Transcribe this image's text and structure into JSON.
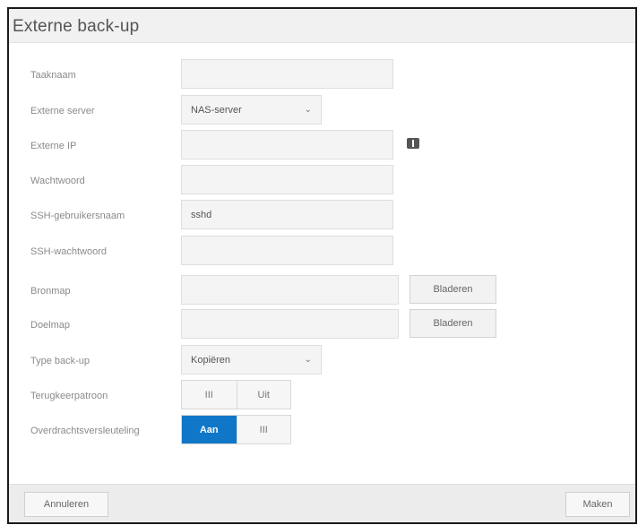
{
  "dialog": {
    "title": "Externe back-up"
  },
  "form": {
    "task_name": {
      "label": "Taaknaam",
      "value": ""
    },
    "remote_server": {
      "label": "Externe server",
      "value": "NAS-server"
    },
    "remote_ip": {
      "label": "Externe IP",
      "value": ""
    },
    "password": {
      "label": "Wachtwoord",
      "value": ""
    },
    "ssh_username": {
      "label": "SSH-gebruikersnaam",
      "value": "sshd"
    },
    "ssh_password": {
      "label": "SSH-wachtwoord",
      "value": ""
    },
    "source_folder": {
      "label": "Bronmap",
      "value": "",
      "browse_label": "Bladeren"
    },
    "dest_folder": {
      "label": "Doelmap",
      "value": "",
      "browse_label": "Bladeren"
    },
    "backup_type": {
      "label": "Type back-up",
      "value": "Kopiëren"
    },
    "restore": {
      "label": "Terugkeerpatroon",
      "on_label": "III",
      "off_label": "Uit",
      "state": "off"
    },
    "transfer": {
      "label": "Overdrachtsversleuteling",
      "on_label": "Aan",
      "off_label": "III",
      "state": "on"
    }
  },
  "footer": {
    "cancel_label": "Annuleren",
    "create_label": "Maken"
  },
  "colors": {
    "accent": "#1077c8",
    "titlebar": "#f1f1f1",
    "footer": "#ececec"
  },
  "icons": {
    "info": "info-icon",
    "dropdown": "chevron-down-icon"
  }
}
